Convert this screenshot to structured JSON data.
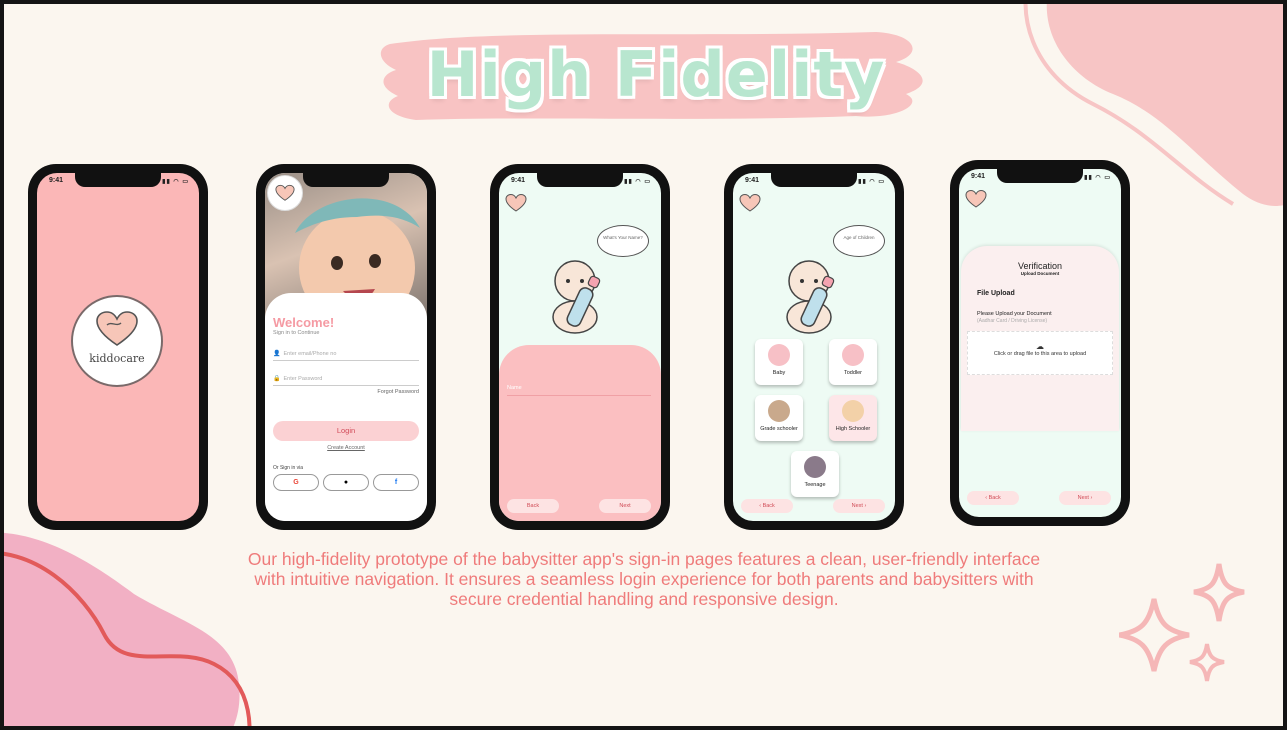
{
  "slide": {
    "title": "High Fidelity",
    "description": "Our high-fidelity prototype of the babysitter app's sign-in pages features a clean, user-friendly interface with intuitive navigation. It ensures a seamless login experience for both parents and babysitters with secure credential handling and responsive design.",
    "colors": {
      "background": "#fbf6ef",
      "title": "#b8e6cf",
      "accent_pink": "#fbb7b7",
      "text_coral": "#ef7b7b",
      "mint": "#eefbf4"
    }
  },
  "status_time": "9:41",
  "phone1": {
    "logo_text": "kiddocare",
    "logo_icon": "heart-icon"
  },
  "phone2": {
    "welcome": "Welcome!",
    "subtitle": "Sign in to Continue",
    "email_placeholder": "Enter email/Phone no",
    "password_placeholder": "Enter Password",
    "forgot": "Forgot Password",
    "login": "Login",
    "create": "Create Account",
    "or_sign_in": "Or Sign in via",
    "social": [
      "G",
      "",
      "f"
    ]
  },
  "phone3": {
    "bubble": "What's Your Name?",
    "name_placeholder": "Name",
    "back": "Back",
    "next": "Next"
  },
  "phone4": {
    "bubble": "Age of Children",
    "categories": [
      "Baby",
      "Toddler",
      "Grade schooler",
      "High Schooler",
      "Teenage"
    ],
    "back": "Back",
    "next": "Next"
  },
  "phone5": {
    "title": "Verification",
    "subtitle": "Upload Document",
    "file_upload": "File Upload",
    "upload_prompt": "Please Upload your Document",
    "upload_hint": "(Aadhar Card / Driving License)",
    "dropzone": "Click or drag file to this area to upload",
    "back": "Back",
    "next": "Next"
  }
}
